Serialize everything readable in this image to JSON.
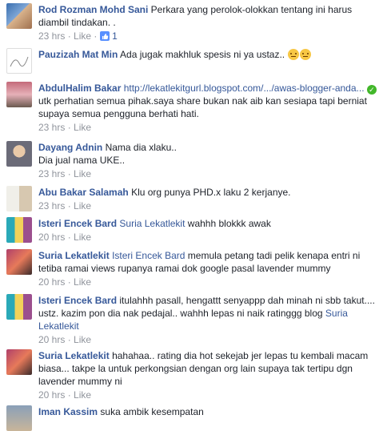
{
  "comments": [
    {
      "author": "Rod Rozman Mohd Sani",
      "text": "Perkara yang perolok-olokkan tentang ini harus diambil tindakan. .",
      "time": "23 hrs",
      "like": "Like",
      "likes": "1",
      "avatar": "rod"
    },
    {
      "author": "Pauzizah Mat Min",
      "text": "Ada jugak makhluk spesis ni ya ustaz..",
      "time": "",
      "like": "",
      "avatar": "pauzizah"
    },
    {
      "author": "AbdulHalim Bakar",
      "link": "http://lekatlekitgurl.blogspot.com/.../awas-blogger-anda...",
      "text": "utk perhatian semua pihak.saya share bukan nak aib kan sesiapa tapi berniat supaya semua pengguna berhati hati.",
      "time": "23 hrs",
      "like": "Like",
      "avatar": "abdulhalim"
    },
    {
      "author": "Dayang Adnin",
      "text": "Nama dia xlaku..",
      "text2": "Dia jual nama UKE..",
      "time": "23 hrs",
      "like": "Like",
      "avatar": "dayang"
    },
    {
      "author": "Abu Bakar Salamah",
      "text": "Klu org punya PHD.x laku 2 kerjanye.",
      "time": "23 hrs",
      "like": "Like",
      "avatar": "abubakar"
    },
    {
      "author": "Isteri Encek Bard",
      "mention": "Suria Lekatlekit",
      "text": "wahhh blokkk awak",
      "time": "20 hrs",
      "like": "Like",
      "avatar": "isteri"
    },
    {
      "author": "Suria Lekatlekit",
      "mention": "Isteri Encek Bard",
      "text": "memula petang tadi pelik kenapa entri ni tetiba ramai views rupanya ramai dok google pasal lavender mummy",
      "time": "20 hrs",
      "like": "Like",
      "avatar": "suria"
    },
    {
      "author": "Isteri Encek Bard",
      "text": "itulahhh pasall, hengattt senyappp dah minah ni sbb takut.... ustz. kazim pon dia nak pedajal.. wahhh lepas ni naik ratinggg blog",
      "mention2": "Suria Lekatlekit",
      "time": "20 hrs",
      "like": "Like",
      "avatar": "isteri"
    },
    {
      "author": "Suria Lekatlekit",
      "text": "hahahaa.. rating dia hot sekejab jer lepas tu kembali macam biasa... takpe la untuk perkongsian dengan org lain supaya tak tertipu dgn lavender mummy ni",
      "time": "20 hrs",
      "like": "Like",
      "avatar": "suria"
    },
    {
      "author": "Iman Kassim",
      "text": "suka ambik kesempatan",
      "avatar": "iman"
    }
  ],
  "colors": {
    "link": "#365899",
    "meta": "#90949c",
    "text": "#1d2129"
  },
  "icons": {
    "like_count": "thumbs-up-icon",
    "emoji": "angry-face-icon",
    "verified": "check-circle-icon"
  }
}
